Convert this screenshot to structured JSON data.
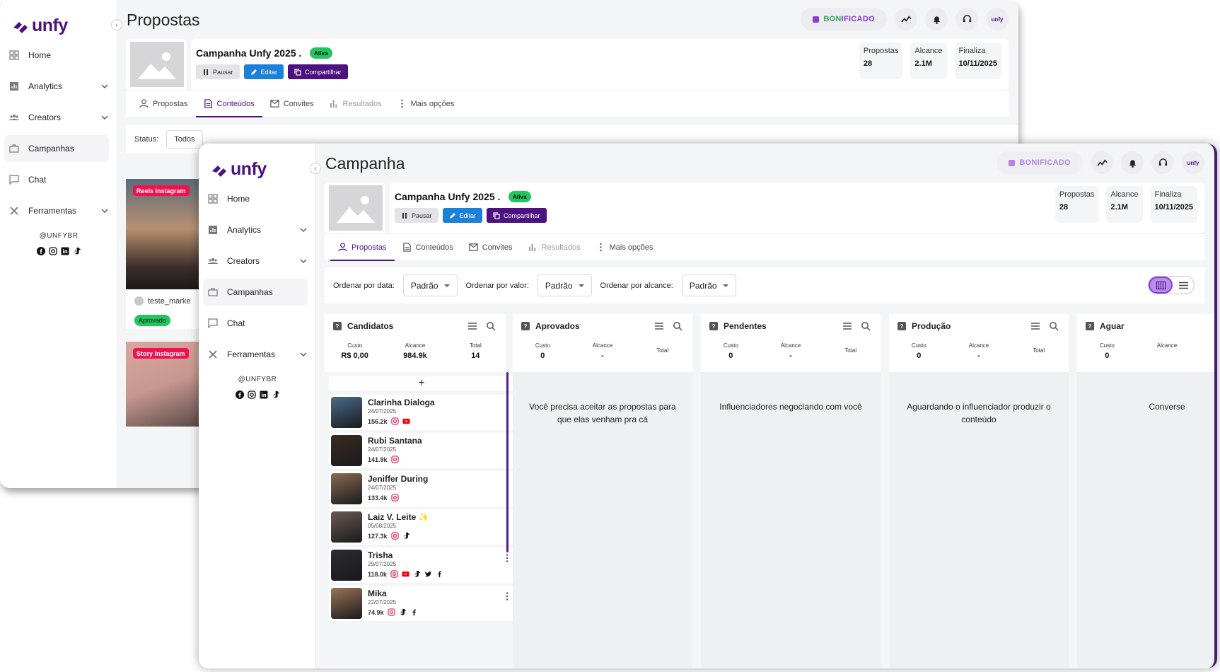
{
  "brand": {
    "name": "unfy",
    "handle": "@UNFYBR",
    "avatar_label": "unfy"
  },
  "nav": {
    "home": "Home",
    "analytics": "Analytics",
    "creators": "Creators",
    "campanhas": "Campanhas",
    "chat": "Chat",
    "ferramentas": "Ferramentas"
  },
  "topbar": {
    "bonificado_a": "BON",
    "bonificado_b": "IFICADO"
  },
  "campaign": {
    "name": "Campanha Unfy 2025 .",
    "status": "Ativa",
    "pause": "Pausar",
    "edit": "Editar",
    "share": "Compartilhar",
    "stats": [
      {
        "label": "Propostas",
        "value": "28"
      },
      {
        "label": "Alcance",
        "value": "2.1M"
      },
      {
        "label": "Finaliza",
        "value": "10/11/2025"
      }
    ]
  },
  "tabs": {
    "propostas": "Propostas",
    "conteudos": "Conteúdos",
    "convites": "Convites",
    "resultados": "Resultados",
    "mais": "Mais opções"
  },
  "window_a": {
    "title": "Propostas",
    "status_label": "Status:",
    "status_value": "Todos",
    "cards": [
      {
        "tag": "Reels Instagram",
        "user": "teste_marke",
        "status": "Aprovado"
      },
      {
        "tag": "Story Instagram"
      }
    ]
  },
  "window_b": {
    "title": "Campanha",
    "filters": [
      {
        "label": "Ordenar por data:",
        "value": "Padrão"
      },
      {
        "label": "Ordenar por valor:",
        "value": "Padrão"
      },
      {
        "label": "Ordenar por alcance:",
        "value": "Padrão"
      }
    ],
    "columns": [
      {
        "title": "Candidatos",
        "custo": "R$ 0,00",
        "alcance": "984.9k",
        "total": "14",
        "message": ""
      },
      {
        "title": "Aprovados",
        "custo": "0",
        "alcance": "-",
        "total": "",
        "message": "Você precisa aceitar as propostas para que elas venham pra cá"
      },
      {
        "title": "Pendentes",
        "custo": "0",
        "alcance": "-",
        "total": "",
        "message": "Influenciadores negociando com você"
      },
      {
        "title": "Produção",
        "custo": "0",
        "alcance": "-",
        "total": "",
        "message": "Aguardando o influenciador produzir o conteúdo"
      },
      {
        "title": "Aguar",
        "custo": "0",
        "alcance": "",
        "total": "",
        "message": "Converse"
      }
    ],
    "stat_labels": {
      "custo": "Custo",
      "alcance": "Alcance",
      "total": "Total"
    },
    "candidates": [
      {
        "name": "Clarinha Dialoga",
        "date": "24/07/2025",
        "reach": "156.2k",
        "networks": [
          "instagram",
          "youtube"
        ],
        "color": "#4b6b8a"
      },
      {
        "name": "Rubi Santana",
        "date": "24/07/2025",
        "reach": "141.9k",
        "networks": [
          "instagram"
        ],
        "color": "#3a2a22"
      },
      {
        "name": "Jeniffer During",
        "date": "24/07/2025",
        "reach": "133.4k",
        "networks": [
          "instagram"
        ],
        "color": "#8a6a50"
      },
      {
        "name": "Laiz V. Leite ✨",
        "date": "05/08/2025",
        "reach": "127.3k",
        "networks": [
          "instagram",
          "tiktok"
        ],
        "color": "#6a5a52"
      },
      {
        "name": "Trisha",
        "date": "29/07/2025",
        "reach": "118.0k",
        "networks": [
          "instagram",
          "youtube",
          "tiktok",
          "twitter",
          "facebook"
        ],
        "color": "#2c2c30"
      },
      {
        "name": "Mika",
        "date": "22/07/2025",
        "reach": "74.9k",
        "networks": [
          "instagram",
          "tiktok",
          "facebook"
        ],
        "color": "#9a7456"
      }
    ]
  }
}
